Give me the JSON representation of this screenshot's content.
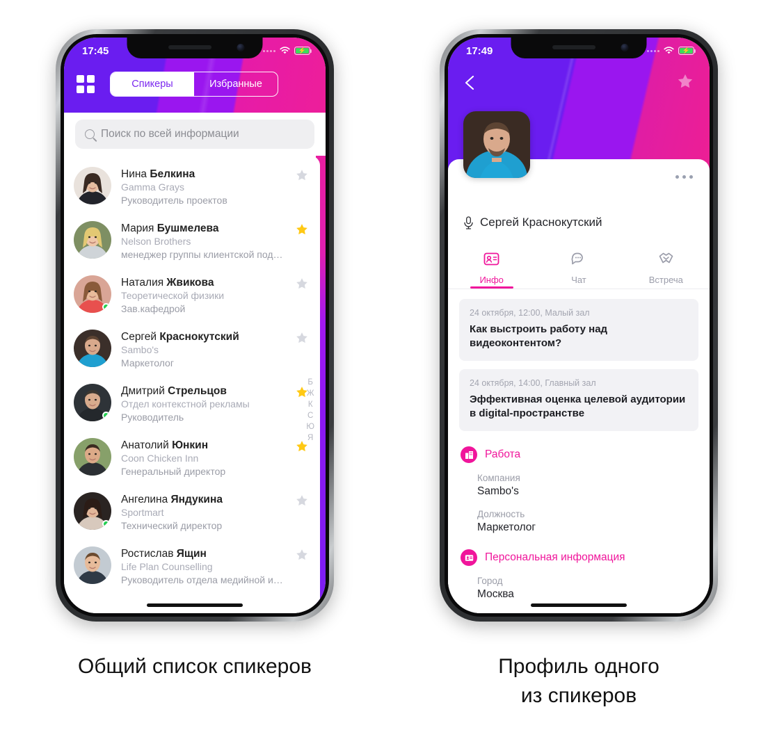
{
  "colors": {
    "purple": "#6a1df0",
    "violet": "#9a16ef",
    "magenta": "#ed1e9a",
    "pink_accent": "#f0159b",
    "star_on": "#ffc915",
    "star_off": "#d6d8df",
    "online_dot": "#22d050"
  },
  "left_phone": {
    "status": {
      "time": "17:45",
      "wifi_icon": "wifi-icon",
      "battery_icon": "battery-charging-icon"
    },
    "topbar": {
      "grid_icon": "grid-menu-icon",
      "segments": [
        {
          "label": "Спикеры",
          "active": true
        },
        {
          "label": "Избранные",
          "active": false
        }
      ]
    },
    "search": {
      "placeholder": "Поиск по всей информации",
      "icon": "search-icon"
    },
    "alphabet_index": [
      "Б",
      "Ж",
      "К",
      "С",
      "Ю",
      "Я"
    ],
    "speakers": [
      {
        "first": "Нина ",
        "last": "Белкина",
        "company": "Gamma Grays",
        "position": "Руководитель проектов",
        "favorite": false,
        "online": false
      },
      {
        "first": "Мария ",
        "last": "Бушмелева",
        "company": "Nelson Brothers",
        "position": "менеджер группы клиентской под…",
        "favorite": true,
        "online": false
      },
      {
        "first": "Наталия ",
        "last": "Жвикова",
        "company": "Теоретической физики",
        "position": "Зав.кафедрой",
        "favorite": false,
        "online": true
      },
      {
        "first": "Сергей ",
        "last": "Краснокутский",
        "company": "Sambo's",
        "position": "Маркетолог",
        "favorite": false,
        "online": false
      },
      {
        "first": "Дмитрий ",
        "last": "Стрельцов",
        "company": "Отдел контекстной рекламы",
        "position": "Руководитель",
        "favorite": true,
        "online": true
      },
      {
        "first": "Анатолий ",
        "last": "Юнкин",
        "company": "Coon Chicken Inn",
        "position": "Генеральный директор",
        "favorite": true,
        "online": false
      },
      {
        "first": "Ангелина ",
        "last": "Яндукина",
        "company": "Sportmart",
        "position": "Технический директор",
        "favorite": false,
        "online": true
      },
      {
        "first": "Ростислав ",
        "last": "Ящин",
        "company": "Life Plan Counselling",
        "position": "Руководитель отдела медийной и…",
        "favorite": false,
        "online": false
      }
    ]
  },
  "right_phone": {
    "status": {
      "time": "17:49",
      "wifi_icon": "wifi-icon",
      "battery_icon": "battery-charging-icon"
    },
    "back_icon": "back-arrow-icon",
    "favorite_icon": "star-icon",
    "more_icon": "more-options-icon",
    "avatar_name": "Сергей Краснокутский",
    "name_icon": "microphone-icon",
    "tabs": [
      {
        "label": "Инфо",
        "icon": "id-card-icon",
        "active": true
      },
      {
        "label": "Чат",
        "icon": "chat-bubble-icon",
        "active": false
      },
      {
        "label": "Встреча",
        "icon": "handshake-icon",
        "active": false
      }
    ],
    "sessions": [
      {
        "meta": "24 октября, 12:00, Малый зал",
        "title": "Как выстроить работу над видеоконтентом?"
      },
      {
        "meta": "24 октября, 14:00, Главный зал",
        "title": "Эффективная оценка целевой аудитории в digital-пространстве"
      }
    ],
    "sections": [
      {
        "title": "Работа",
        "icon": "building-icon",
        "fields": [
          {
            "key": "Компания",
            "value": "Sambo's"
          },
          {
            "key": "Должность",
            "value": "Маркетолог"
          }
        ]
      },
      {
        "title": "Персональная информация",
        "icon": "id-badge-icon",
        "fields": [
          {
            "key": "Город",
            "value": "Москва"
          }
        ]
      }
    ]
  },
  "captions": {
    "left": "Общий список спикеров",
    "right": "Профиль одного\nиз спикеров"
  }
}
